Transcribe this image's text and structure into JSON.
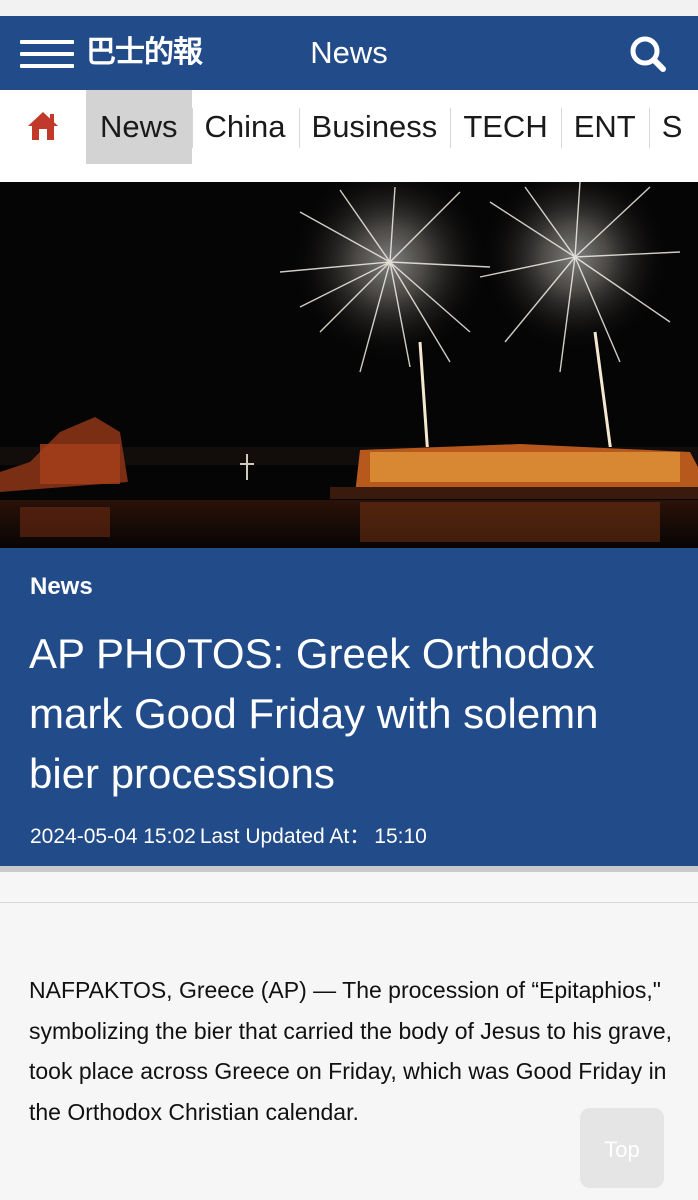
{
  "header": {
    "logo_text": "巴士的報",
    "title": "News",
    "menu_icon": "hamburger-menu-icon",
    "search_icon": "search-icon",
    "background_color": "#224b8a"
  },
  "nav": {
    "home_icon": "home-icon",
    "home_icon_color": "#c0392b",
    "tabs": [
      {
        "label": "News",
        "active": true
      },
      {
        "label": "China",
        "active": false
      },
      {
        "label": "Business",
        "active": false
      },
      {
        "label": "TECH",
        "active": false
      },
      {
        "label": "ENT",
        "active": false
      },
      {
        "label": "S",
        "active": false
      }
    ]
  },
  "article": {
    "category": "News",
    "title": "AP PHOTOS: Greek Orthodox mark Good Friday with solemn bier processions",
    "published": "2024-05-04 15:02",
    "updated_label": "Last Updated At：",
    "updated_time": "15:10",
    "body": "NAFPAKTOS, Greece (AP) — The procession of “Epitaphios,\" symbolizing the bier that carried the body of Jesus to his grave, took place across Greece on Friday, which was Good Friday in the Orthodox Christian calendar."
  },
  "back_to_top": {
    "label": "Top"
  }
}
